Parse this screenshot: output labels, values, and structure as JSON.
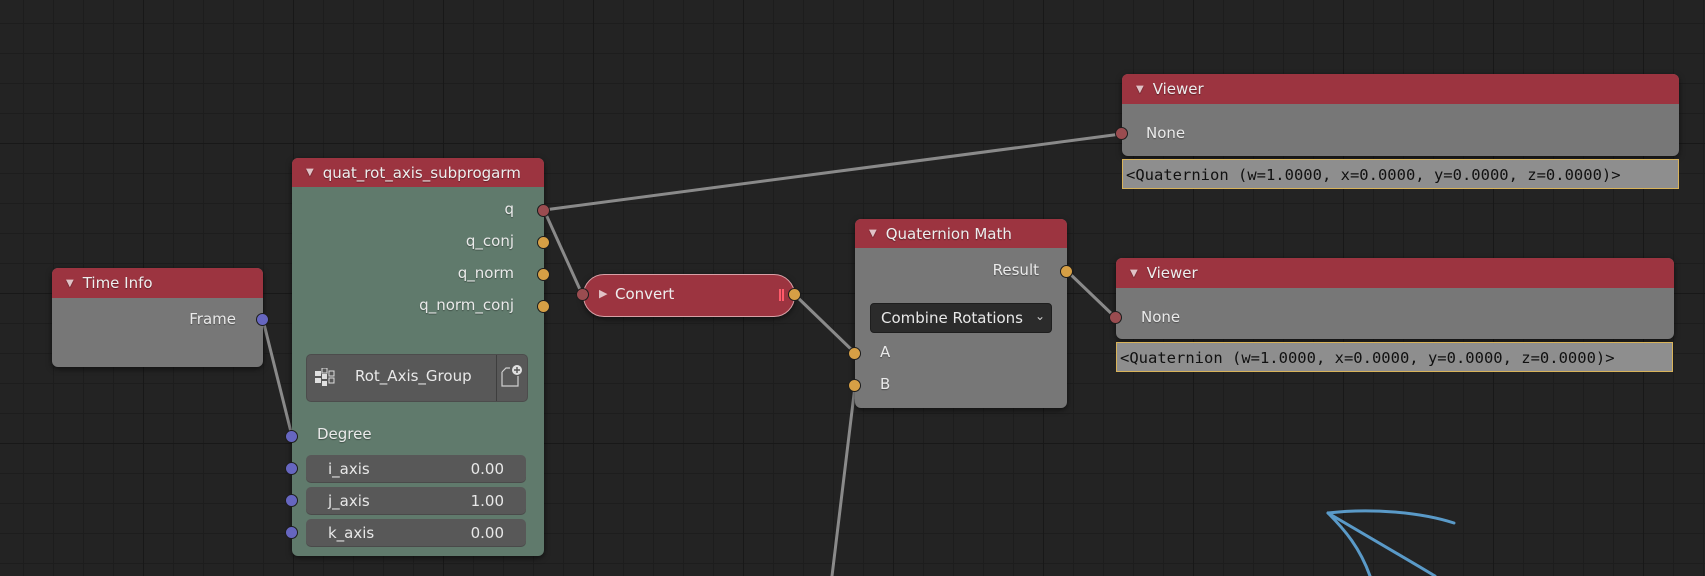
{
  "editor": {
    "type": "node-editor",
    "accent_colors": {
      "header": "#9c3440",
      "group_body": "#607a6c",
      "node_body": "#777777",
      "socket_quaternion": "#9a4c50",
      "socket_float": "#d69f45",
      "socket_integer": "#6666c0",
      "annotation_stroke": "#5a9ac8"
    }
  },
  "nodes": {
    "time_info": {
      "title": "Time Info",
      "outputs": [
        "Frame"
      ]
    },
    "group": {
      "title": "quat_rot_axis_subprogarm",
      "outputs": [
        "q",
        "q_conj",
        "q_norm",
        "q_norm_conj"
      ],
      "node_tree": "Rot_Axis_Group",
      "inputs": [
        {
          "label": "Degree"
        },
        {
          "label": "i_axis",
          "value": "0.00"
        },
        {
          "label": "j_axis",
          "value": "1.00"
        },
        {
          "label": "k_axis",
          "value": "0.00"
        }
      ]
    },
    "convert": {
      "title": "Convert",
      "collapsed": true
    },
    "quat_math": {
      "title": "Quaternion Math",
      "outputs": [
        "Result"
      ],
      "operation": "Combine Rotations",
      "inputs": [
        "A",
        "B"
      ]
    },
    "viewer_top": {
      "title": "Viewer",
      "input_label": "None",
      "value_text": "<Quaternion (w=1.0000, x=0.0000, y=0.0000, z=0.0000)>"
    },
    "viewer_bottom": {
      "title": "Viewer",
      "input_label": "None",
      "value_text": "<Quaternion (w=1.0000, x=0.0000, y=0.0000, z=0.0000)>"
    }
  }
}
